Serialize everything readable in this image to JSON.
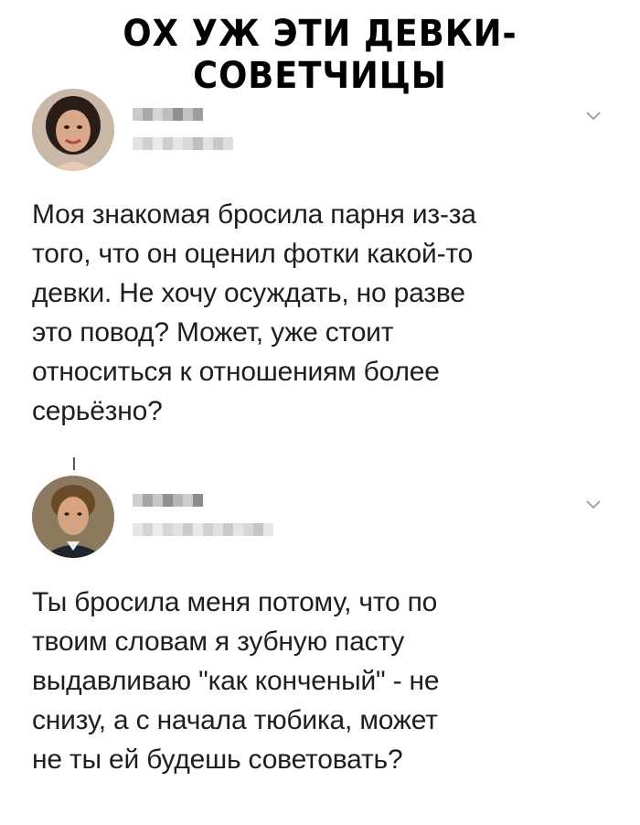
{
  "header": {
    "title": "ОХ УЖ ЭТИ ДЕВКИ-СОВЕТЧИЦЫ"
  },
  "tweets": [
    {
      "avatar_icon": "woman-avatar",
      "menu_icon": "chevron-down-icon",
      "text": "Моя знакомая бросила парня из-за\nтого, что он оценил фотки какой-то\nдевки. Не хочу осуждать, но разве\nэто повод? Может, уже стоит\nотноситься к отношениям более\nсерьёзно?"
    },
    {
      "avatar_icon": "man-avatar",
      "menu_icon": "chevron-down-icon",
      "text": "Ты бросила меня потому, что по\nтвоим словам я зубную пасту\nвыдавливаю \"как конченый\" - не\nснизу, а с начала тюбика, может\nне ты ей будешь советовать?"
    }
  ]
}
